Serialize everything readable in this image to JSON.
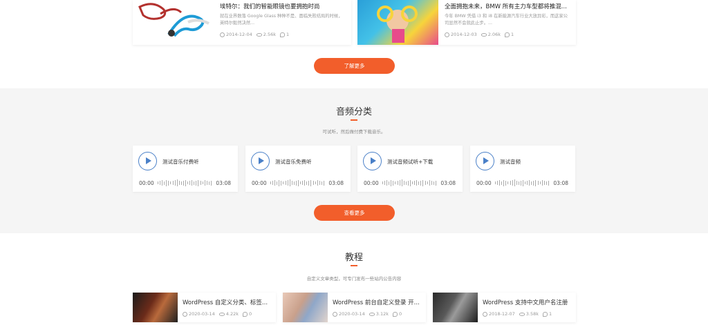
{
  "articles": [
    {
      "title": "埃特尔：我们的智能眼镜也要拥抱时尚",
      "excerpt": "就在业界数落 Google Glass 种种不是、面临失败结局的时候，英特尔毅然决然...",
      "date": "2014-12-04",
      "views": "2.56k",
      "comments": "1"
    },
    {
      "title": "全面拥抱未来，BMW 所有主力车型都将推混...",
      "excerpt": "今年 BMW 凭借 i3 和 i8 在新能源汽车行业大放异彩，而这家公司显然不会就此止步。...",
      "date": "2014-12-03",
      "views": "2.06k",
      "comments": "1"
    }
  ],
  "more_button": "了解更多",
  "audio_section": {
    "title": "音频分类",
    "subtitle": "可试听，然后做付费下载音乐。",
    "tracks": [
      {
        "title": "测试音乐付费听",
        "start": "00:00",
        "end": "03:08"
      },
      {
        "title": "测试音乐免费听",
        "start": "00:00",
        "end": "03:08"
      },
      {
        "title": "测试音频试听+下载",
        "start": "00:00",
        "end": "03:08"
      },
      {
        "title": "测试音频",
        "start": "00:00",
        "end": "03:08"
      }
    ],
    "more_button": "查看更多"
  },
  "tutorial_section": {
    "title": "教程",
    "subtitle": "自定义文章类型，可专门发布一些站内公告内容",
    "items": [
      {
        "title": "WordPress 自定义分类、标签...",
        "date": "2020-03-14",
        "views": "4.22k",
        "comments": "0"
      },
      {
        "title": "WordPress 前台自定义登录 开...",
        "date": "2020-03-14",
        "views": "3.12k",
        "comments": "0"
      },
      {
        "title": "WordPress 支持中文用户名注册",
        "date": "2018-12-07",
        "views": "3.58k",
        "comments": "1"
      }
    ]
  },
  "colors": {
    "accent": "#f25e2b",
    "play": "#4a80c8",
    "section_bg": "#f5f5f5"
  }
}
